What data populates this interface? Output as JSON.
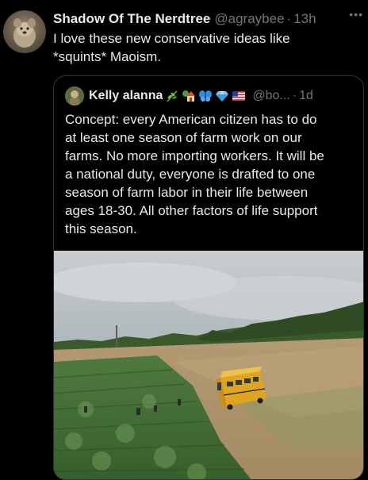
{
  "tweet": {
    "author_name": "Shadow Of The Nerdtree",
    "handle": "@agraybee",
    "separator": "·",
    "time": "13h",
    "more_icon": "more-horizontal-icon",
    "text_line1": "I love these new conservative ideas like",
    "text_line2": "*squints* Maoism."
  },
  "quoted": {
    "author_name": "Kelly alanna",
    "emojis": [
      "herb-icon",
      "house-with-garden-icon",
      "butterfly-icon",
      "gem-icon",
      "us-flag-icon"
    ],
    "handle": "@bo...",
    "separator": "·",
    "time": "1d",
    "text_lines": [
      "Concept: every American citizen has to do",
      "at least one season of farm work on our",
      "farms. No more importing workers. It will be",
      "a national duty, everyone is drafted to one",
      "season of farm labor in their life between",
      "ages 18-30. All other factors of life support",
      "this season."
    ],
    "media_description_icon": "farm-field-photo"
  },
  "colors": {
    "background": "#000000",
    "text": "#e7e9ea",
    "secondary": "#71767b",
    "border": "#2f3336"
  }
}
